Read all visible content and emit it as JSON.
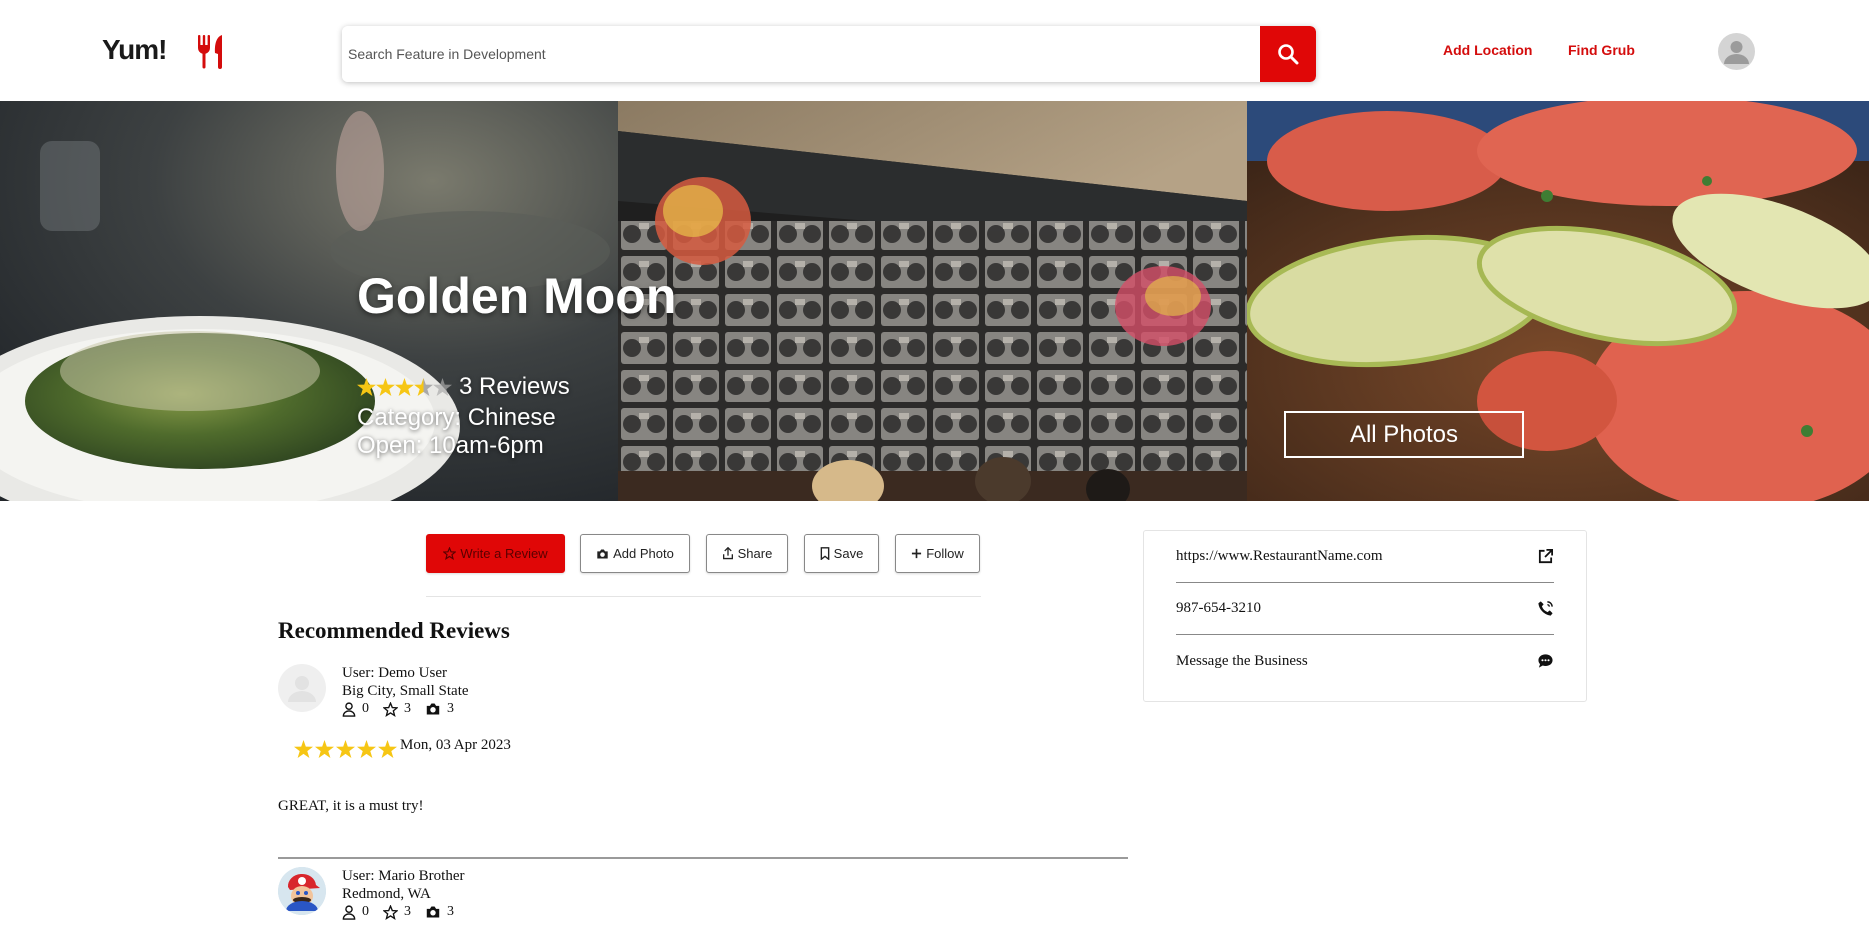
{
  "header": {
    "logo_text": "Yum!",
    "logo_icon": "utensils-icon",
    "search_placeholder": "Search Feature in Development",
    "search_icon": "search-icon",
    "nav": [
      {
        "label": "Add Location"
      },
      {
        "label": "Find Grub"
      }
    ],
    "avatar_icon": "user-avatar-icon"
  },
  "hero": {
    "name": "Golden Moon",
    "rating": 3.5,
    "rating_max": 5,
    "reviews_label": "3 Reviews",
    "category_line": "Category: Chinese",
    "hours_line": "Open: 10am-6pm",
    "all_photos_label": "All Photos"
  },
  "actions": [
    {
      "label": "Write a Review",
      "icon": "star-outline-icon"
    },
    {
      "label": "Add Photo",
      "icon": "camera-icon"
    },
    {
      "label": "Share",
      "icon": "share-icon"
    },
    {
      "label": "Save",
      "icon": "bookmark-icon"
    },
    {
      "label": "Follow",
      "icon": "plus-icon"
    }
  ],
  "reviews_section": {
    "title": "Recommended Reviews",
    "reviews": [
      {
        "user": "User: Demo User",
        "location": "Big City, Small State",
        "friends": "0",
        "review_count": "3",
        "photos": "3",
        "rating": 5,
        "date": "Mon, 03 Apr 2023",
        "text": "GREAT, it is a must try!"
      },
      {
        "user": "User: Mario Brother",
        "location": "Redmond, WA",
        "friends": "0",
        "review_count": "3",
        "photos": "3"
      }
    ]
  },
  "info_card": {
    "website": "https://www.RestaurantName.com",
    "website_icon": "external-link-icon",
    "phone": "987-654-3210",
    "phone_icon": "phone-icon",
    "message": "Message the Business",
    "message_icon": "chat-bubble-icon"
  },
  "colors": {
    "brand_red": "#e00707",
    "star_yellow": "#f6c614"
  }
}
